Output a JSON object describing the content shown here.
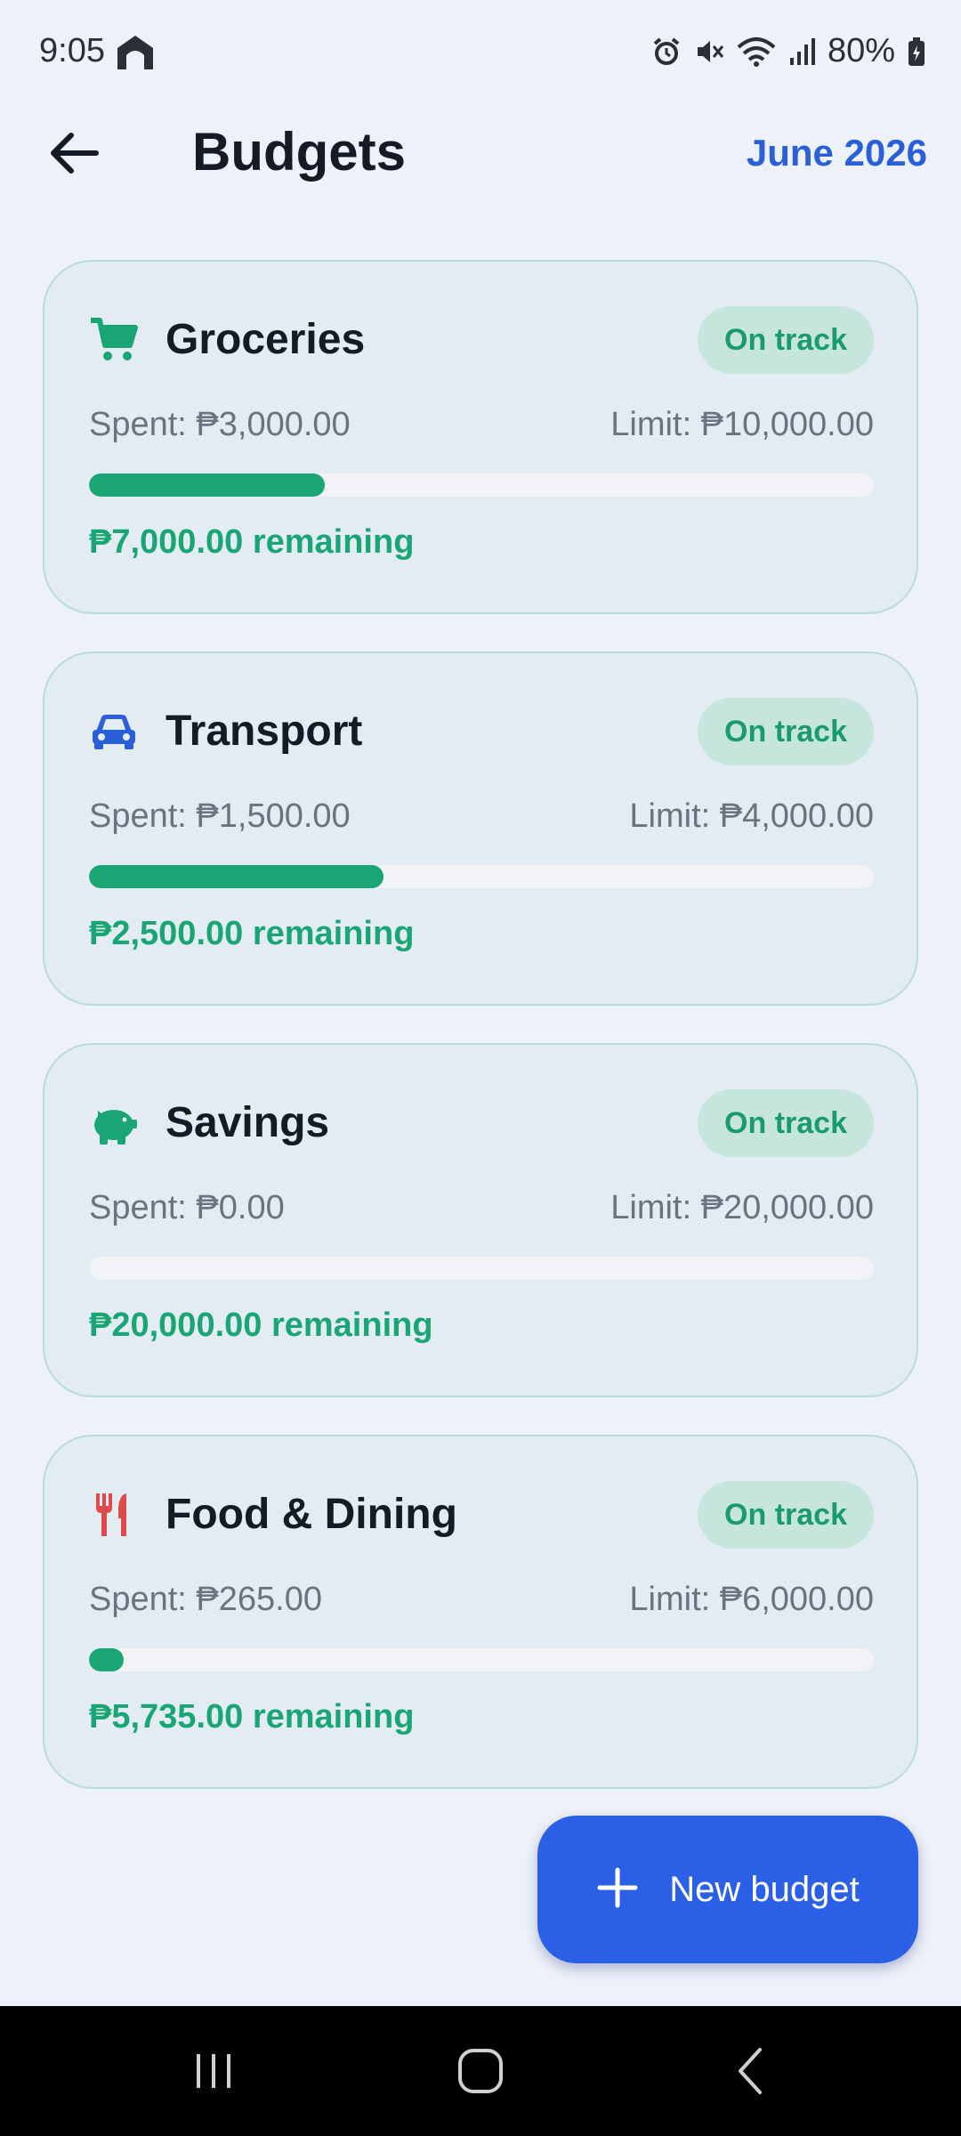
{
  "status_bar": {
    "time": "9:05",
    "battery": "80%",
    "icons": [
      "home-icon",
      "alarm-icon",
      "mute-icon",
      "wifi-icon",
      "signal-icon",
      "battery-icon"
    ]
  },
  "header": {
    "title": "Budgets",
    "month": "June 2026",
    "back_icon": "arrow-left-icon"
  },
  "budgets": [
    {
      "name": "Groceries",
      "icon": "cart-icon",
      "icon_color": "#1aa674",
      "status": "On track",
      "spent": "Spent: ₱3,000.00",
      "limit": "Limit: ₱10,000.00",
      "progress_fraction": 0.3,
      "remaining": "₱7,000.00 remaining"
    },
    {
      "name": "Transport",
      "icon": "car-icon",
      "icon_color": "#2b5fd9",
      "status": "On track",
      "spent": "Spent: ₱1,500.00",
      "limit": "Limit: ₱4,000.00",
      "progress_fraction": 0.375,
      "remaining": "₱2,500.00 remaining"
    },
    {
      "name": "Savings",
      "icon": "piggy-bank-icon",
      "icon_color": "#1aa674",
      "status": "On track",
      "spent": "Spent: ₱0.00",
      "limit": "Limit: ₱20,000.00",
      "progress_fraction": 0.0,
      "remaining": "₱20,000.00 remaining"
    },
    {
      "name": "Food & Dining",
      "icon": "fork-knife-icon",
      "icon_color": "#e04a4a",
      "status": "On track",
      "spent": "Spent: ₱265.00",
      "limit": "Limit: ₱6,000.00",
      "progress_fraction": 0.044,
      "remaining": "₱5,735.00 remaining"
    }
  ],
  "fab": {
    "label": "New budget",
    "icon": "plus-icon"
  },
  "nav_bar": {
    "items": [
      "recent-apps-icon",
      "home-nav-icon",
      "back-nav-icon"
    ]
  },
  "colors": {
    "accent": "#2b5fe6",
    "success": "#1aa674",
    "background": "#edf1f9"
  }
}
